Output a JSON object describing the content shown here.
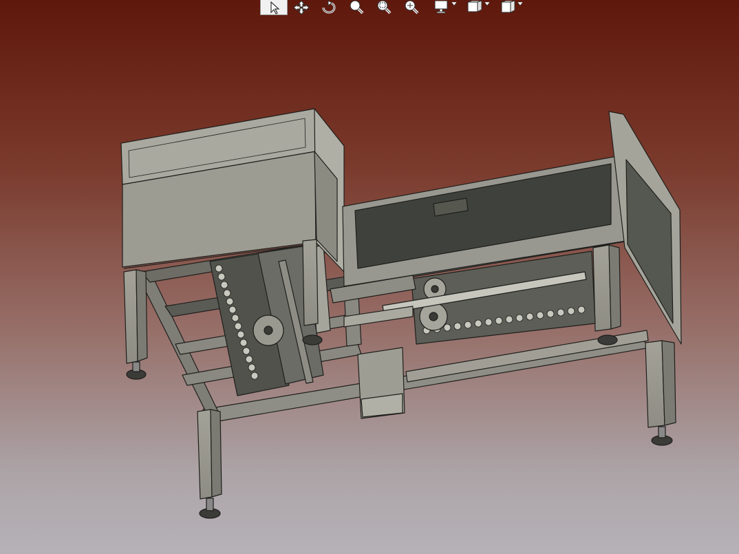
{
  "app": {
    "background_top": "#5f180c",
    "background_bottom": "#b6b2b8"
  },
  "toolbar": {
    "tools": [
      {
        "id": "select",
        "icon": "select-arrow-icon",
        "active": true
      },
      {
        "id": "pan",
        "icon": "pan-move-icon"
      },
      {
        "id": "rotate",
        "icon": "rotate-icon"
      },
      {
        "id": "zoom",
        "icon": "zoom-icon"
      },
      {
        "id": "zoom-window",
        "icon": "zoom-window-icon"
      },
      {
        "id": "zoom-fit",
        "icon": "zoom-fit-icon"
      },
      {
        "id": "display-mode",
        "icon": "monitor-icon",
        "dropdown": true
      },
      {
        "id": "render-style",
        "icon": "render-style-icon",
        "dropdown": true
      },
      {
        "id": "view-orientation",
        "icon": "view-cube-icon",
        "dropdown": true
      }
    ]
  },
  "model": {
    "description_icon": "conveyor-machine-3d-model",
    "steel_color": "#9c9b91",
    "dark_color": "#3f423c",
    "edge_color": "#1e1e1c"
  }
}
